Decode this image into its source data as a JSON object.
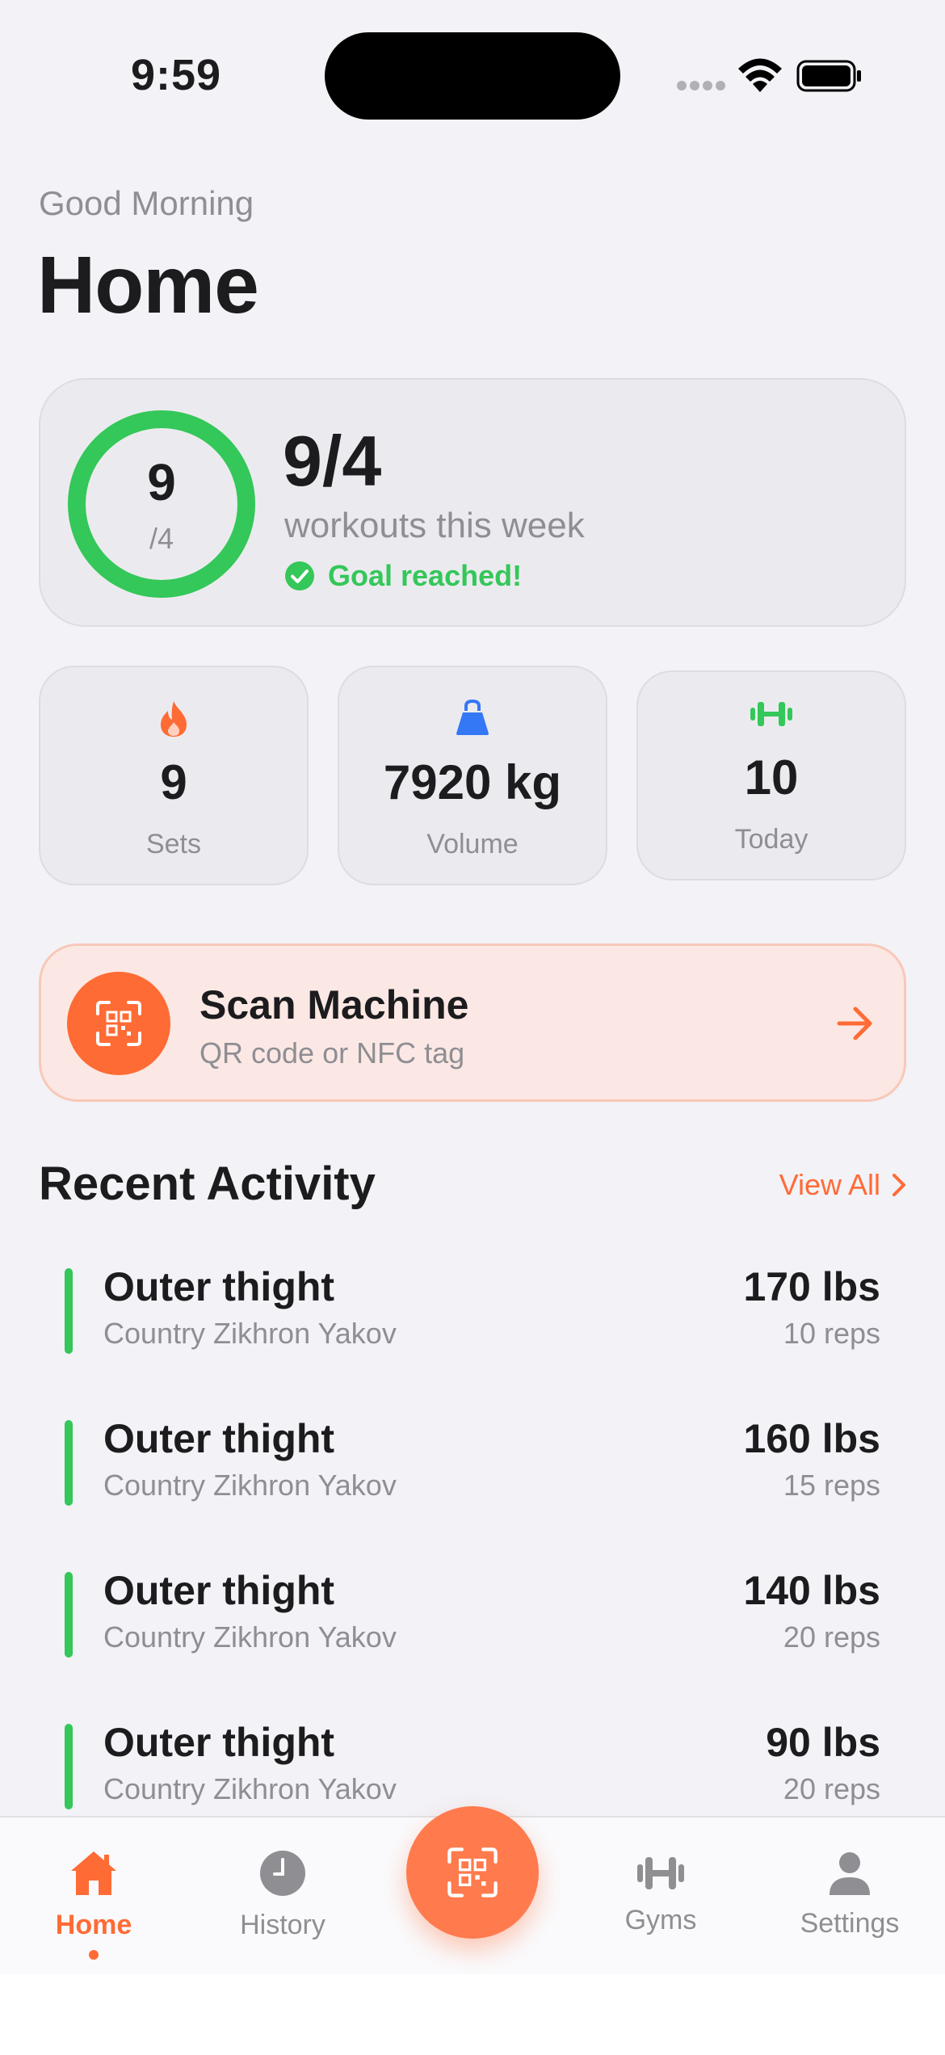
{
  "status_bar": {
    "time": "9:59"
  },
  "header": {
    "greeting": "Good Morning",
    "title": "Home"
  },
  "goal": {
    "completed": 9,
    "ring_value": "9",
    "ring_of": "/4",
    "headline": "9/4",
    "subtitle": "workouts this week",
    "status": "Goal reached!",
    "progress_fraction": 1.0
  },
  "stats": [
    {
      "icon": "flame-icon",
      "value": "9",
      "label": "Sets",
      "color": "#ff6b35"
    },
    {
      "icon": "kettlebell-icon",
      "value": "7920 kg",
      "label": "Volume",
      "color": "#3478f6"
    },
    {
      "icon": "dumbbell-icon",
      "value": "10",
      "label": "Today",
      "color": "#34c759"
    }
  ],
  "scan": {
    "title": "Scan Machine",
    "subtitle": "QR code or NFC tag"
  },
  "recent": {
    "title": "Recent Activity",
    "view_all": "View All",
    "items": [
      {
        "name": "Outer thight",
        "location": "Country Zikhron Yakov",
        "weight": "170 lbs",
        "reps": "10 reps"
      },
      {
        "name": "Outer thight",
        "location": "Country Zikhron Yakov",
        "weight": "160 lbs",
        "reps": "15 reps"
      },
      {
        "name": "Outer thight",
        "location": "Country Zikhron Yakov",
        "weight": "140 lbs",
        "reps": "20 reps"
      },
      {
        "name": "Outer thight",
        "location": "Country Zikhron Yakov",
        "weight": "90 lbs",
        "reps": "20 reps"
      }
    ]
  },
  "tabs": [
    {
      "label": "Home",
      "icon": "house-icon",
      "active": true
    },
    {
      "label": "History",
      "icon": "clock-icon",
      "active": false
    },
    {
      "label": "Gyms",
      "icon": "dumbbell-icon",
      "active": false
    },
    {
      "label": "Settings",
      "icon": "person-icon",
      "active": false
    }
  ],
  "colors": {
    "accent": "#ff6b35",
    "success": "#34c759",
    "secondary_text": "#8e8e93",
    "background": "#f2f2f7"
  }
}
